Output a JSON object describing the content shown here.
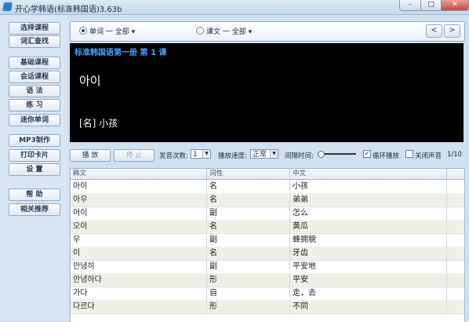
{
  "window": {
    "title": "开心学韩语(标准韩国语)3.63b"
  },
  "sidebar": {
    "items": [
      {
        "label": "选择课程"
      },
      {
        "label": "词汇查找"
      },
      {
        "label": "基础课程"
      },
      {
        "label": "会话课程"
      },
      {
        "label": "语  法"
      },
      {
        "label": "练  习"
      },
      {
        "label": "迷你单词"
      },
      {
        "label": "MP3制作"
      },
      {
        "label": "打印卡片"
      },
      {
        "label": "设  置"
      },
      {
        "label": "帮  助"
      },
      {
        "label": "相关推荐"
      }
    ]
  },
  "topbar": {
    "word_radio": {
      "label": "单词 一 全部",
      "selected": true
    },
    "text_radio": {
      "label": "课文 一 全部",
      "selected": false
    },
    "prev": "<",
    "next": ">"
  },
  "display": {
    "lesson_title": "标准韩国语第一册 第 1 课",
    "word": "아이",
    "meaning": "[名] 小孩"
  },
  "controls": {
    "play": "播 放",
    "stop": "停 止",
    "repeat_label": "发音次数:",
    "repeat_value": "1",
    "speed_label": "播放速度:",
    "speed_value": "正常",
    "interval_label": "间隔时间:",
    "loop_label": "循环播放",
    "loop_checked": true,
    "mute_label": "关闭声音",
    "mute_checked": false,
    "page_indicator": "1/10"
  },
  "table": {
    "columns": [
      "韩文",
      "词性",
      "中文"
    ],
    "rows": [
      [
        "아이",
        "名",
        "小孩"
      ],
      [
        "아우",
        "名",
        "弟弟"
      ],
      [
        "어이",
        "副",
        "怎么"
      ],
      [
        "오이",
        "名",
        "黄瓜"
      ],
      [
        "우",
        "副",
        "蜂拥貌"
      ],
      [
        "이",
        "名",
        "牙齿"
      ],
      [
        "안녕히",
        "副",
        "平安地"
      ],
      [
        "안녕하다",
        "形",
        "平安"
      ],
      [
        "가다",
        "自",
        "走，去"
      ],
      [
        "다르다",
        "形",
        "不同"
      ]
    ]
  },
  "colors": {
    "accent": "#4aa0ff",
    "display_bg": "#000000",
    "row_alt": "#eef1e6"
  }
}
